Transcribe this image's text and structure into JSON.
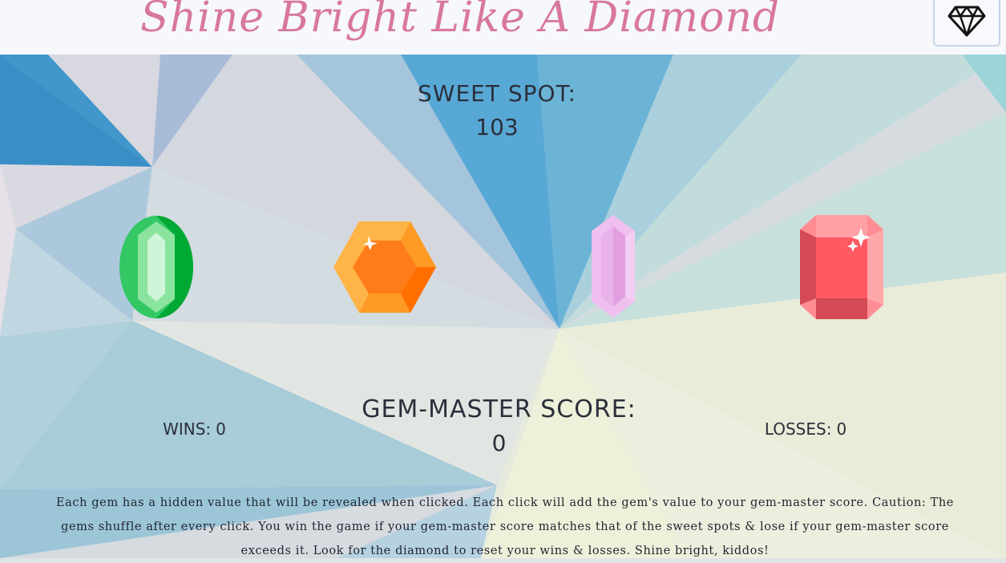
{
  "header": {
    "title": "Shine Bright Like A Diamond",
    "reset_icon": "diamond-icon"
  },
  "sweet_spot": {
    "label": "SWEET SPOT:",
    "value": "103"
  },
  "gems": [
    {
      "name": "emerald",
      "color": "#33c864"
    },
    {
      "name": "topaz",
      "color": "#ff8c1a"
    },
    {
      "name": "amethyst",
      "color": "#e8a8e8"
    },
    {
      "name": "ruby",
      "color": "#ff5a64"
    }
  ],
  "score": {
    "label": "GEM-MASTER SCORE:",
    "value": "0"
  },
  "wins": {
    "label": "WINS:",
    "value": "0"
  },
  "losses": {
    "label": "LOSSES:",
    "value": "0"
  },
  "instructions": "Each gem has a hidden value that will be revealed when clicked. Each click will add the gem's value to your gem-master score. Caution: The gems shuffle after every click. You win the game if your gem-master score matches that of the sweet spots & lose if your gem-master score exceeds it. Look for the diamond to reset your wins & losses. Shine bright, kiddos!",
  "colors": {
    "title": "#d8779e",
    "header_bg": "#f6f8fb",
    "accent_blue": "#3b8fc8"
  }
}
